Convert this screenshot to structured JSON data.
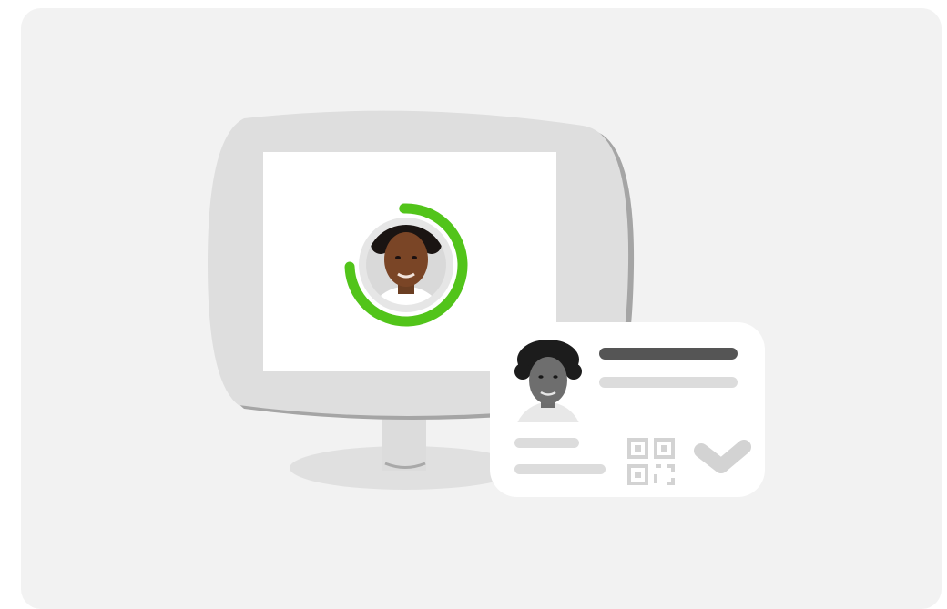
{
  "colors": {
    "background": "#ffffff",
    "panel": "#f2f2f2",
    "monitor_body": "#dedede",
    "monitor_shadow": "#a5a5a5",
    "stand_base": "#e0e0e0",
    "screen": "#ffffff",
    "progress_ring": "#52c41a",
    "avatar_ring_bg": "#e6e6e6",
    "id_card": "#ffffff",
    "text_bar_dark": "#555555",
    "text_bar_light": "#dcdcdc",
    "check_mark": "#d3d3d3"
  },
  "liveness_check": {
    "progress_fraction": 0.75
  },
  "id_card": {
    "verified": true
  },
  "icons": {
    "face": "face-portrait-icon",
    "document_photo": "document-photo-icon",
    "qr": "qr-code-icon",
    "check": "check-mark-icon"
  }
}
